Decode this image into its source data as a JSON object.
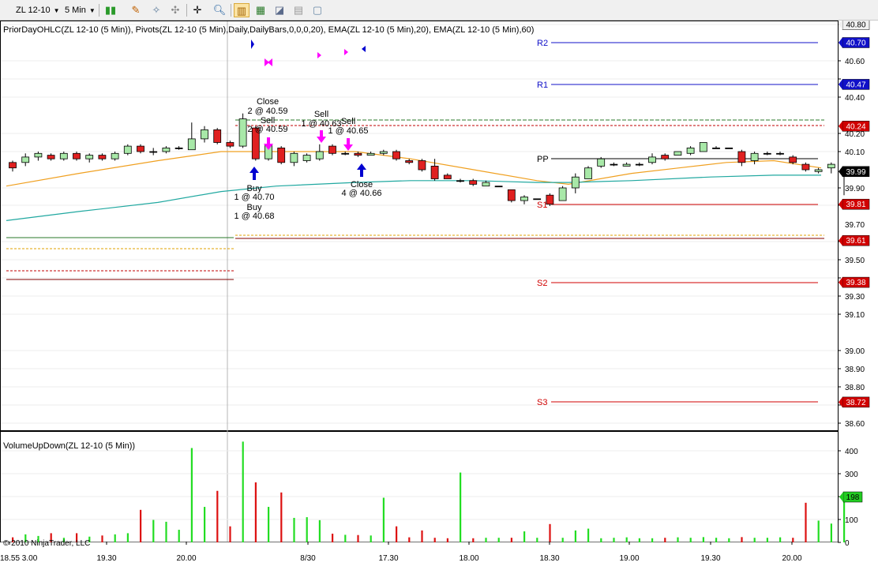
{
  "toolbar": {
    "instrument": "ZL 12-10",
    "interval": "5 Min",
    "icons": [
      "candlestick-icon",
      "drawing-pencil-icon",
      "magic-wand-icon",
      "crosshair-icon",
      "zoom-icon",
      "chart-trader-icon",
      "bar-style-icon",
      "strategy-icon",
      "properties-icon",
      "new-window-icon"
    ]
  },
  "price_panel": {
    "indicator_label": "PriorDayOHLC(ZL 12-10 (5 Min)), Pivots(ZL 12-10 (5 Min),Daily,DailyBars,0,0,0,20), EMA(ZL 12-10 (5 Min),20), EMA(ZL 12-10 (5 Min),60)",
    "y_ticks": [
      "40.80",
      "40.60",
      "40.40",
      "40.20",
      "40.10",
      "39.90",
      "39.70",
      "39.50",
      "39.30",
      "39.10",
      "39.00",
      "38.90",
      "38.80",
      "38.60"
    ]
  },
  "volume_panel": {
    "indicator_label": "VolumeUpDown(ZL 12-10 (5 Min))",
    "y_ticks": [
      "400",
      "300",
      "200",
      "100",
      "0"
    ],
    "current_badge": "198"
  },
  "x_axis": {
    "ticks": [
      "18.55",
      "19.30",
      "20.00",
      "8/30",
      "17.30",
      "18.00",
      "18.30",
      "19.00",
      "19.30",
      "20.00"
    ],
    "start_label": "18.55 3.00"
  },
  "copyright": "© 2010 NinjaTrader, LLC",
  "chart_data": {
    "type": "candlestick",
    "y_range": [
      38.55,
      40.83
    ],
    "pivots": [
      {
        "label": "R2",
        "value": 40.7,
        "color": "#1010c8"
      },
      {
        "label": "R1",
        "value": 40.47,
        "color": "#1010c8"
      },
      {
        "label": "PP",
        "value": 40.06,
        "color": "#000000"
      },
      {
        "label": "S1",
        "value": 39.81,
        "color": "#d00000"
      },
      {
        "label": "S2",
        "value": 39.38,
        "color": "#d00000"
      },
      {
        "label": "S3",
        "value": 38.72,
        "color": "#d00000"
      }
    ],
    "price_badges": [
      {
        "text": "40.80",
        "value": 40.8,
        "bg": "#f0f0f0",
        "fg": "#000000"
      },
      {
        "text": "40.70",
        "value": 40.7,
        "bg": "#1010c8",
        "fg": "#ffffff"
      },
      {
        "text": "40.47",
        "value": 40.47,
        "bg": "#1010c8",
        "fg": "#ffffff"
      },
      {
        "text": "40.24",
        "value": 40.24,
        "bg": "#d00000",
        "fg": "#ffffff"
      },
      {
        "text": "39.99",
        "value": 39.99,
        "bg": "#000000",
        "fg": "#ffffff"
      },
      {
        "text": "39.81",
        "value": 39.81,
        "bg": "#d00000",
        "fg": "#ffffff"
      },
      {
        "text": "39.61",
        "value": 39.61,
        "bg": "#d00000",
        "fg": "#ffffff"
      },
      {
        "text": "39.38",
        "value": 39.38,
        "bg": "#d00000",
        "fg": "#ffffff"
      },
      {
        "text": "38.72",
        "value": 38.72,
        "bg": "#d00000",
        "fg": "#ffffff"
      }
    ],
    "trade_labels": [
      {
        "lines": [
          "Close",
          "2 @ 40.59"
        ]
      },
      {
        "lines": [
          "Sell",
          "2 @ 40.59"
        ]
      },
      {
        "lines": [
          "Sell",
          "1 @ 40.63"
        ]
      },
      {
        "lines": [
          "Sell",
          "1 @ 40.65"
        ]
      },
      {
        "lines": [
          "Buy",
          "1 @ 40.70"
        ]
      },
      {
        "lines": [
          "Buy",
          "1 @ 40.68"
        ]
      },
      {
        "lines": [
          "Close",
          "4 @ 40.66"
        ]
      }
    ],
    "candles": [
      [
        40.04,
        40.01,
        40.05,
        39.99
      ],
      [
        40.04,
        40.07,
        40.09,
        40.02
      ],
      [
        40.07,
        40.09,
        40.1,
        40.05
      ],
      [
        40.08,
        40.06,
        40.09,
        40.05
      ],
      [
        40.06,
        40.09,
        40.1,
        40.05
      ],
      [
        40.09,
        40.06,
        40.1,
        40.05
      ],
      [
        40.06,
        40.08,
        40.09,
        40.04
      ],
      [
        40.08,
        40.06,
        40.09,
        40.05
      ],
      [
        40.06,
        40.09,
        40.1,
        40.05
      ],
      [
        40.09,
        40.13,
        40.14,
        40.08
      ],
      [
        40.13,
        40.1,
        40.14,
        40.09
      ],
      [
        40.1,
        40.1,
        40.12,
        40.08
      ],
      [
        40.1,
        40.12,
        40.13,
        40.09
      ],
      [
        40.12,
        40.12,
        40.13,
        40.11
      ],
      [
        40.11,
        40.17,
        40.26,
        40.11
      ],
      [
        40.17,
        40.22,
        40.24,
        40.15
      ],
      [
        40.22,
        40.15,
        40.23,
        40.14
      ],
      [
        40.15,
        40.13,
        40.16,
        40.12
      ],
      [
        40.13,
        40.28,
        40.31,
        40.12
      ],
      [
        40.23,
        40.06,
        40.24,
        40.05
      ],
      [
        40.06,
        40.14,
        40.16,
        40.05
      ],
      [
        40.12,
        40.04,
        40.13,
        40.03
      ],
      [
        40.04,
        40.09,
        40.1,
        40.02
      ],
      [
        40.05,
        40.08,
        40.09,
        40.04
      ],
      [
        40.06,
        40.1,
        40.14,
        40.05
      ],
      [
        40.13,
        40.09,
        40.14,
        40.08
      ],
      [
        40.09,
        40.09,
        40.1,
        40.08
      ],
      [
        40.09,
        40.08,
        40.1,
        40.07
      ],
      [
        40.08,
        40.09,
        40.1,
        40.08
      ],
      [
        40.09,
        40.1,
        40.11,
        40.08
      ],
      [
        40.1,
        40.06,
        40.11,
        40.05
      ],
      [
        40.05,
        40.04,
        40.06,
        40.03
      ],
      [
        40.05,
        40.0,
        40.06,
        39.99
      ],
      [
        40.02,
        39.95,
        40.06,
        39.94
      ],
      [
        39.97,
        39.95,
        39.98,
        39.95
      ],
      [
        39.94,
        39.94,
        39.95,
        39.93
      ],
      [
        39.94,
        39.92,
        39.95,
        39.91
      ],
      [
        39.91,
        39.93,
        39.94,
        39.91
      ],
      [
        39.91,
        39.91,
        39.91,
        39.91
      ],
      [
        39.89,
        39.83,
        39.89,
        39.82
      ],
      [
        39.83,
        39.85,
        39.86,
        39.81
      ],
      [
        39.84,
        39.84,
        39.84,
        39.84
      ],
      [
        39.86,
        39.81,
        39.87,
        39.8
      ],
      [
        39.83,
        39.9,
        39.91,
        39.83
      ],
      [
        39.9,
        39.96,
        39.98,
        39.87
      ],
      [
        39.95,
        40.01,
        40.02,
        39.95
      ],
      [
        40.02,
        40.06,
        40.07,
        40.01
      ],
      [
        40.03,
        40.03,
        40.04,
        40.02
      ],
      [
        40.02,
        40.03,
        40.04,
        40.02
      ],
      [
        40.03,
        40.03,
        40.04,
        40.02
      ],
      [
        40.04,
        40.07,
        40.09,
        40.03
      ],
      [
        40.08,
        40.06,
        40.09,
        40.05
      ],
      [
        40.08,
        40.1,
        40.1,
        40.08
      ],
      [
        40.09,
        40.12,
        40.13,
        40.08
      ],
      [
        40.1,
        40.15,
        40.15,
        40.1
      ],
      [
        40.12,
        40.12,
        40.13,
        40.12
      ],
      [
        40.12,
        40.12,
        40.12,
        40.12
      ],
      [
        40.1,
        40.04,
        40.11,
        40.02
      ],
      [
        40.05,
        40.09,
        40.1,
        40.03
      ],
      [
        40.09,
        40.09,
        40.1,
        40.08
      ],
      [
        40.09,
        40.09,
        40.1,
        40.08
      ],
      [
        40.07,
        40.04,
        40.08,
        40.03
      ],
      [
        40.03,
        40.0,
        40.04,
        39.99
      ],
      [
        39.99,
        40.0,
        40.01,
        39.98
      ],
      [
        40.01,
        40.03,
        40.04,
        39.98
      ],
      [
        39.98,
        39.99,
        40.0,
        39.86
      ]
    ],
    "ema20": [
      [
        8,
        39.91
      ],
      [
        100,
        39.98
      ],
      [
        200,
        40.05
      ],
      [
        280,
        40.1
      ],
      [
        350,
        40.1
      ],
      [
        450,
        40.1
      ],
      [
        520,
        40.06
      ],
      [
        600,
        40.0
      ],
      [
        680,
        39.94
      ],
      [
        720,
        39.92
      ],
      [
        760,
        39.95
      ],
      [
        800,
        39.98
      ],
      [
        860,
        40.01
      ],
      [
        920,
        40.04
      ],
      [
        980,
        40.05
      ],
      [
        1040,
        40.01
      ]
    ],
    "ema60": [
      [
        8,
        39.72
      ],
      [
        100,
        39.77
      ],
      [
        200,
        39.82
      ],
      [
        280,
        39.88
      ],
      [
        350,
        39.91
      ],
      [
        450,
        39.93
      ],
      [
        520,
        39.94
      ],
      [
        600,
        39.94
      ],
      [
        680,
        39.93
      ],
      [
        720,
        39.93
      ],
      [
        800,
        39.94
      ],
      [
        900,
        39.96
      ],
      [
        980,
        39.97
      ],
      [
        1040,
        39.97
      ]
    ],
    "volume": [
      22,
      35,
      28,
      40,
      20,
      40,
      25,
      30,
      35,
      40,
      142,
      98,
      90,
      55,
      412,
      155,
      225,
      70,
      440,
      262,
      155,
      218,
      107,
      110,
      97,
      38,
      33,
      32,
      30,
      195,
      70,
      22,
      52,
      20,
      18,
      305,
      18,
      20,
      20,
      20,
      48,
      20,
      80,
      20,
      52,
      60,
      18,
      20,
      22,
      18,
      18,
      20,
      22,
      20,
      23,
      20,
      18,
      23,
      20,
      20,
      22,
      20,
      173,
      95,
      82,
      210
    ]
  }
}
